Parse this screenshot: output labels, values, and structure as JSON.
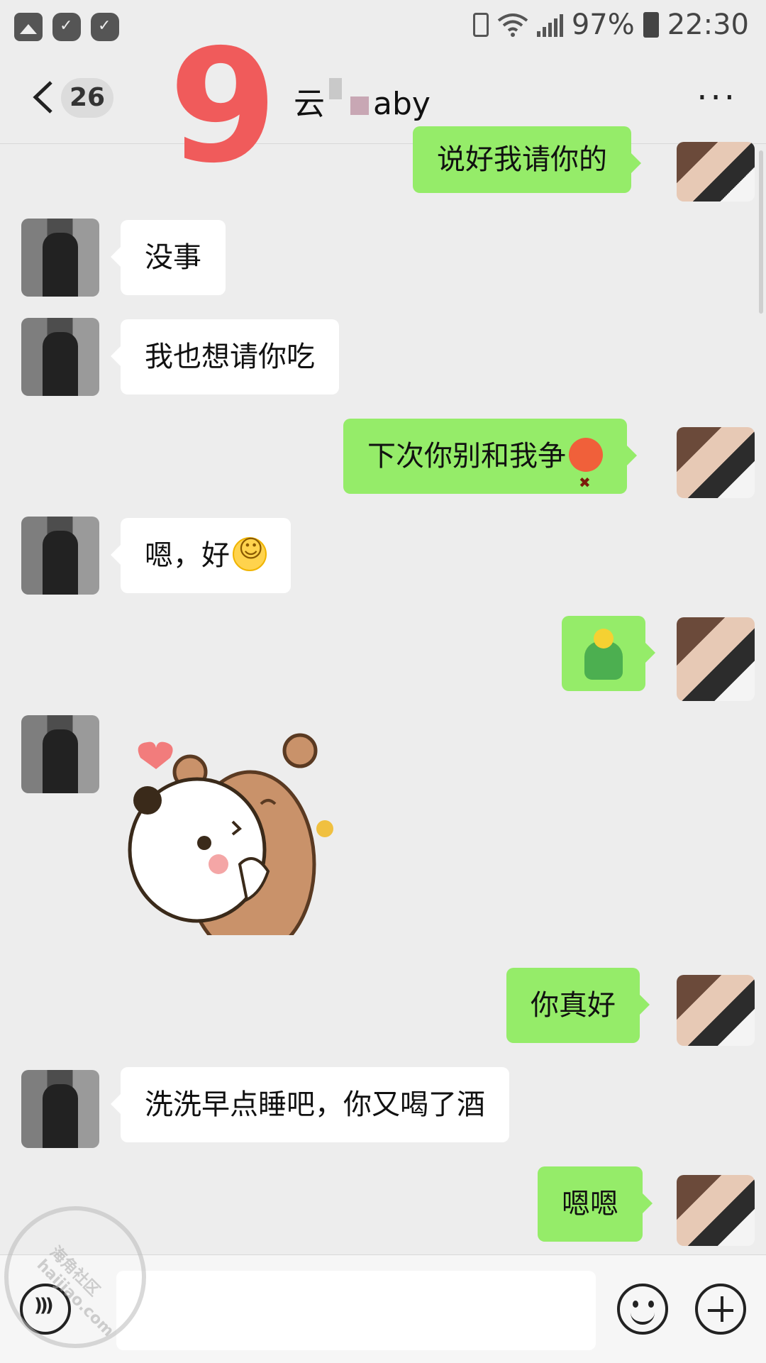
{
  "status_bar": {
    "battery": "97%",
    "time": "22:30"
  },
  "header": {
    "unread_count": "26",
    "overlay_number": "9",
    "title_prefix": "云",
    "title_suffix": "aby"
  },
  "messages": [
    {
      "side": "out",
      "text": "说好我请你的"
    },
    {
      "side": "in",
      "text": "没事"
    },
    {
      "side": "in",
      "text": "我也想请你吃"
    },
    {
      "side": "out",
      "text": "下次你别和我争",
      "emoji": "angry-emoji"
    },
    {
      "side": "in",
      "text": "嗯，好",
      "emoji": "smile-emoji"
    },
    {
      "side": "out",
      "text": "",
      "emoji": "figure-emoji"
    },
    {
      "side": "in",
      "type": "sticker",
      "sticker": "bear-hug-sticker"
    },
    {
      "side": "out",
      "text": "你真好"
    },
    {
      "side": "in",
      "text": "洗洗早点睡吧，你又喝了酒"
    },
    {
      "side": "out",
      "text": "嗯嗯"
    }
  ],
  "watermark": {
    "line1": "海角社区",
    "line2": "haijiao.com"
  },
  "colors": {
    "background": "#ededed",
    "outgoing_bubble": "#95ec69",
    "incoming_bubble": "#ffffff",
    "overlay_number": "#f05b5b"
  },
  "icons": [
    "image-icon",
    "wechat-check-icon",
    "wifi-icon",
    "signal-icon",
    "battery-icon",
    "back-arrow-icon",
    "more-icon",
    "voice-icon",
    "emoji-icon",
    "plus-icon"
  ]
}
